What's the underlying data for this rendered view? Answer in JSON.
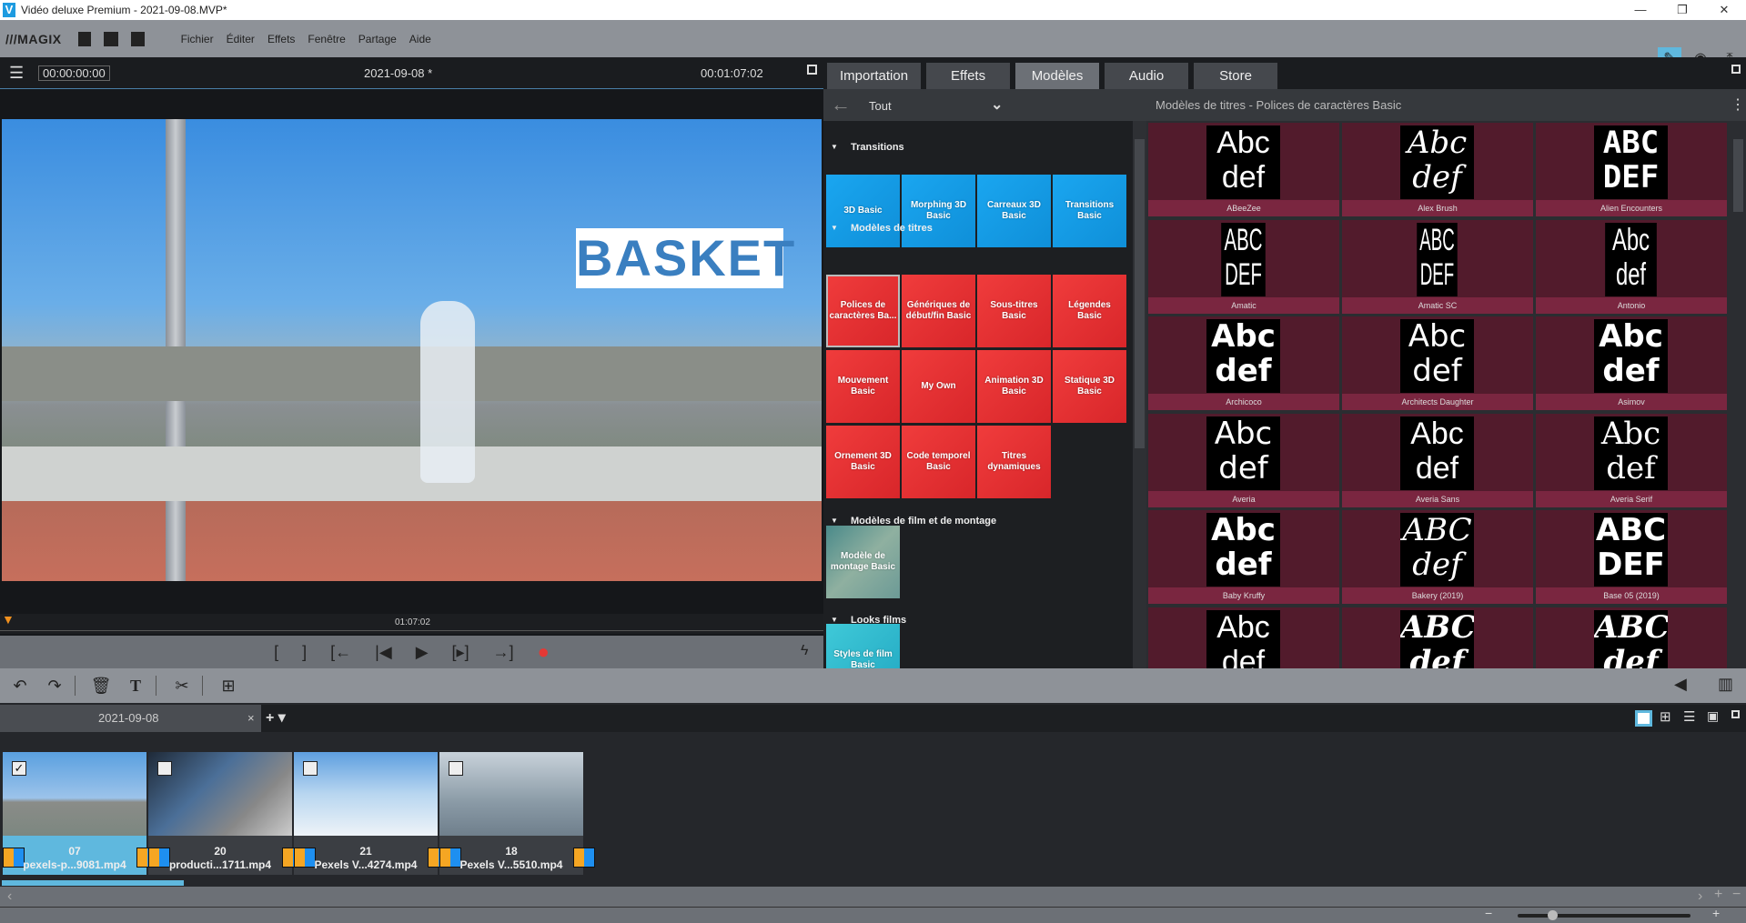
{
  "window": {
    "title": "Vidéo deluxe Premium - 2021-09-08.MVP*",
    "logo": "V",
    "controls": [
      "minimize-icon",
      "restore-icon",
      "close-icon"
    ]
  },
  "menubar": {
    "brand": "///MAGIX",
    "items": [
      "Fichier",
      "Éditer",
      "Effets",
      "Fenêtre",
      "Partage",
      "Aide"
    ]
  },
  "preview": {
    "timecode_start": "00:00:00:00",
    "project": "2021-09-08 *",
    "duration": "00:01:07:02",
    "ruler_label": "01:07:02",
    "overlay_text": "BASKET"
  },
  "transport": {
    "buttons": [
      "[",
      "]",
      "[←",
      "|◀",
      "▶",
      "[▸]",
      "→]",
      "●"
    ]
  },
  "tabs": [
    {
      "label": "Importation"
    },
    {
      "label": "Effets"
    },
    {
      "label": "Modèles",
      "active": true
    },
    {
      "label": "Audio"
    },
    {
      "label": "Store"
    }
  ],
  "catlist": {
    "filter": "Tout",
    "sections": [
      {
        "title": "Transitions",
        "color": "blue",
        "tiles": [
          "3D Basic",
          "Morphing 3D Basic",
          "Carreaux 3D Basic",
          "Transitions Basic"
        ]
      },
      {
        "title": "Modèles de titres",
        "color": "red",
        "tiles": [
          "Polices de caractères Ba...",
          "Génériques de début/fin Basic",
          "Sous-titres Basic",
          "Légendes Basic",
          "Mouvement Basic",
          "My Own",
          "Animation 3D Basic",
          "Statique 3D Basic",
          "Ornement 3D Basic",
          "Code temporel Basic",
          "Titres dynamiques"
        ]
      },
      {
        "title": "Modèles de film et de montage",
        "color": "mont",
        "tiles": [
          "Modèle de montage Basic"
        ]
      },
      {
        "title": "Looks films",
        "color": "teal",
        "tiles": [
          "Styles de film Basic"
        ]
      }
    ]
  },
  "fontpanel": {
    "title": "Modèles de titres - Polices de caractères Basic",
    "fonts": [
      {
        "name": "ABeeZee",
        "a": "Abc",
        "b": "def"
      },
      {
        "name": "Alex Brush",
        "a": "Abc",
        "b": "def"
      },
      {
        "name": "Alien Encounters",
        "a": "ABC",
        "b": "DEF"
      },
      {
        "name": "Amatic",
        "a": "ABC",
        "b": "DEF"
      },
      {
        "name": "Amatic SC",
        "a": "ABC",
        "b": "DEF"
      },
      {
        "name": "Antonio",
        "a": "Abc",
        "b": "def"
      },
      {
        "name": "Archicoco",
        "a": "Abc",
        "b": "def"
      },
      {
        "name": "Architects Daughter",
        "a": "Abc",
        "b": "def"
      },
      {
        "name": "Asimov",
        "a": "Abc",
        "b": "def"
      },
      {
        "name": "Averia",
        "a": "Abc",
        "b": "def"
      },
      {
        "name": "Averia Sans",
        "a": "Abc",
        "b": "def"
      },
      {
        "name": "Averia Serif",
        "a": "Abc",
        "b": "def"
      },
      {
        "name": "Baby Kruffy",
        "a": "Abc",
        "b": "def"
      },
      {
        "name": "Bakery (2019)",
        "a": "ABC",
        "b": "def"
      },
      {
        "name": "Base 05 (2019)",
        "a": "ABC",
        "b": "DEF"
      },
      {
        "name": "",
        "a": "Abc",
        "b": "def"
      },
      {
        "name": "",
        "a": "ABC",
        "b": "def"
      },
      {
        "name": "",
        "a": "ABC",
        "b": "def"
      }
    ]
  },
  "projecttab": {
    "label": "2021-09-08"
  },
  "clips": [
    {
      "num": "07",
      "name": "pexels-p...9081.mp4",
      "checked": true
    },
    {
      "num": "20",
      "name": "producti...1711.mp4",
      "checked": false
    },
    {
      "num": "21",
      "name": "Pexels V...4274.mp4",
      "checked": false
    },
    {
      "num": "18",
      "name": "Pexels V...5510.mp4",
      "checked": false
    }
  ],
  "colors": {
    "accent": "#5fb8de",
    "record": "#e53935",
    "title_tile": "#e8302f",
    "transition_tile": "#1aa6f0",
    "font_cell": "#521b2c"
  }
}
